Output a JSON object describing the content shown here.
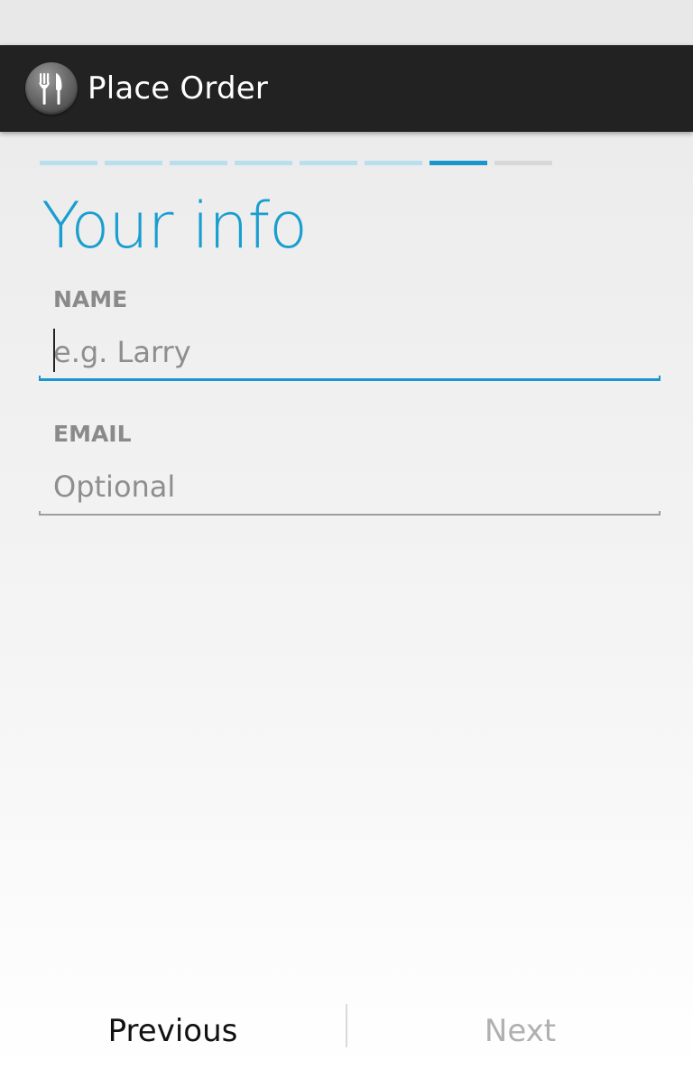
{
  "action_bar": {
    "title": "Place Order",
    "icon": "fork-knife-icon"
  },
  "progress": {
    "total_steps": 8,
    "current_step": 7
  },
  "page": {
    "title": "Your info"
  },
  "form": {
    "name": {
      "label": "NAME",
      "placeholder": "e.g. Larry",
      "value": ""
    },
    "email": {
      "label": "EMAIL",
      "placeholder": "Optional",
      "value": ""
    }
  },
  "footer": {
    "previous_label": "Previous",
    "next_label": "Next"
  },
  "colors": {
    "accent": "#1996cc",
    "action_bar": "#222222",
    "progress_done": "#b8dfec",
    "progress_todo": "#d8d8d8",
    "disabled_text": "#b0b0b0"
  }
}
